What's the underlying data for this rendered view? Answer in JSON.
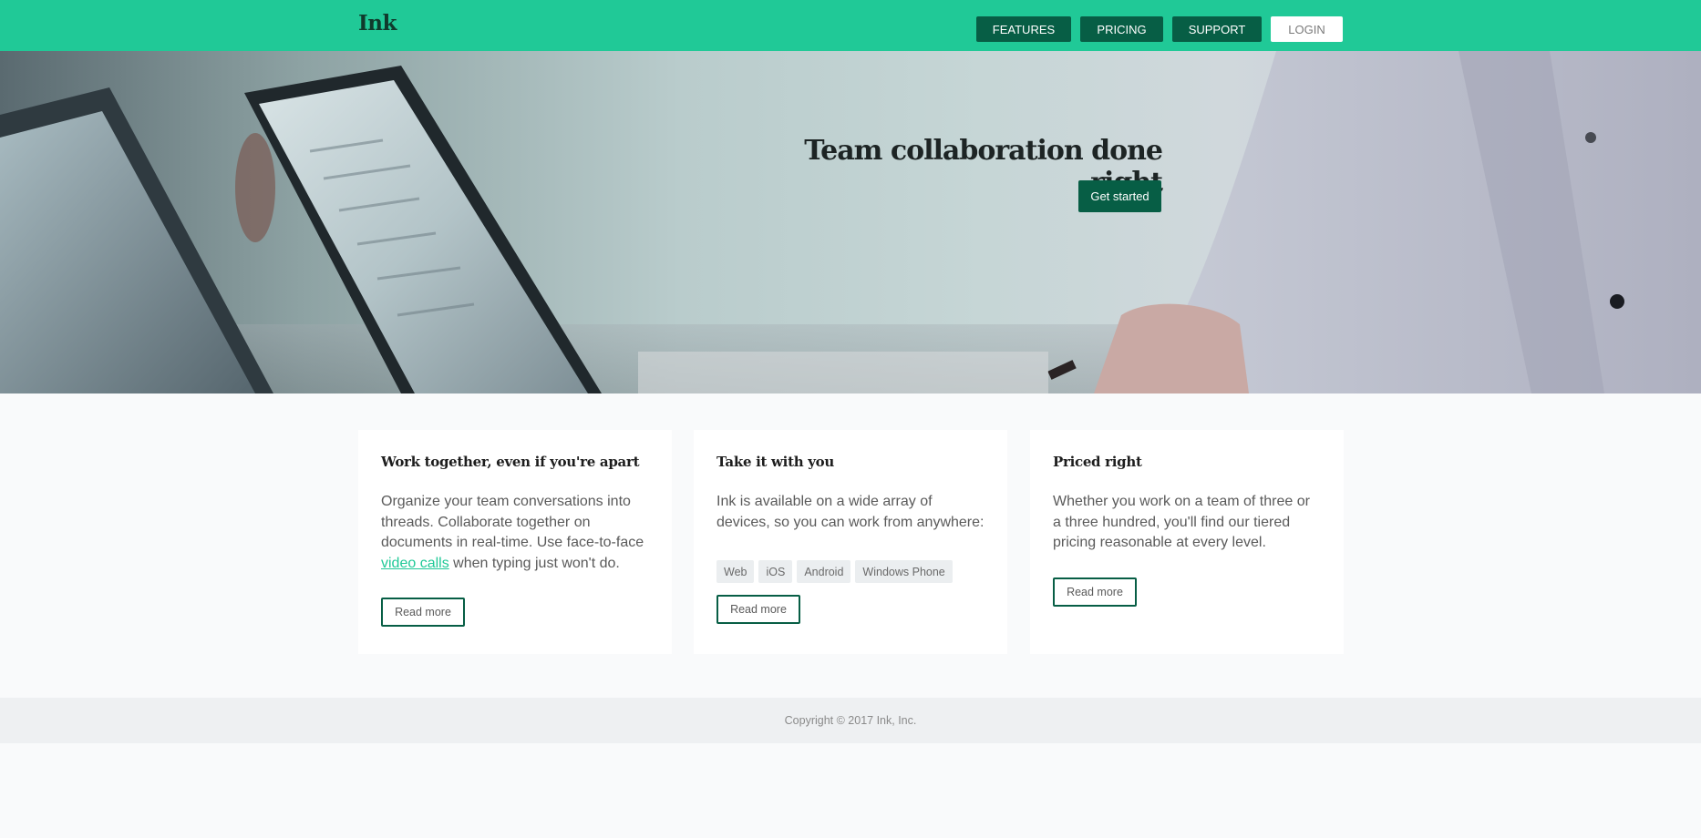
{
  "header": {
    "logo": "Ink",
    "nav": {
      "features": "FEATURES",
      "pricing": "PRICING",
      "support": "SUPPORT",
      "login": "LOGIN"
    }
  },
  "hero": {
    "title": "Team collaboration done right",
    "cta_label": "Get started"
  },
  "cards": [
    {
      "title": "Work together, even if you're apart",
      "text_before_link": "Organize your team conversations into threads. Collaborate together on documents in real-time. Use face-to-face ",
      "link_text": "video calls",
      "text_after_link": " when typing just won't do.",
      "button_label": "Read more"
    },
    {
      "title": "Take it with you",
      "text": "Ink is available on a wide array of devices, so you can work from anywhere:",
      "tags": [
        "Web",
        "iOS",
        "Android",
        "Windows Phone"
      ],
      "button_label": "Read more"
    },
    {
      "title": "Priced right",
      "text": "Whether you work on a team of three or a three hundred, you'll find our tiered pricing reasonable at every level.",
      "button_label": "Read more"
    }
  ],
  "footer": {
    "copyright": "Copyright © 2017 Ink, Inc."
  },
  "colors": {
    "brand": "#20c997",
    "brand_dark": "#075e45",
    "page_bg": "#f9fafb"
  }
}
